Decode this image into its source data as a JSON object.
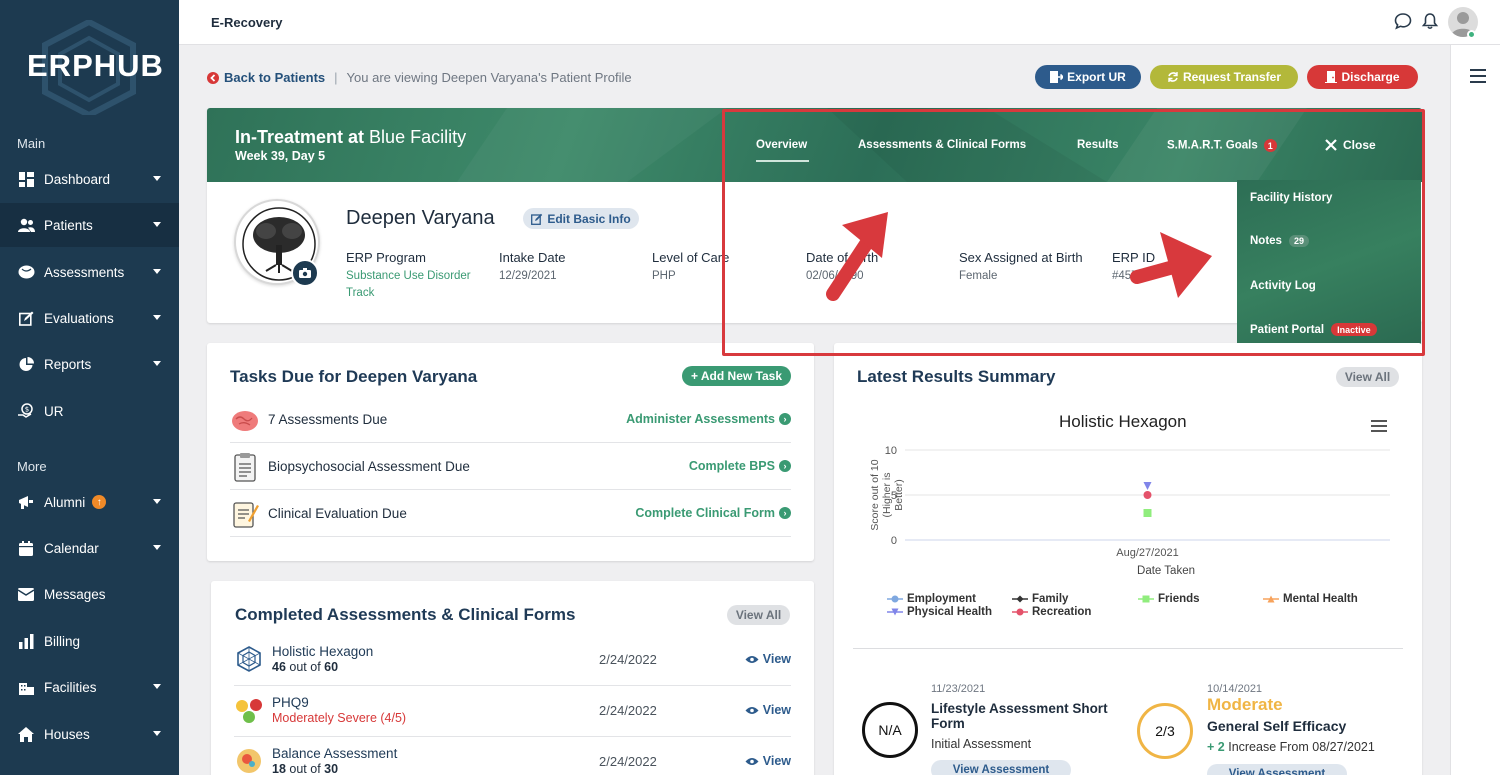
{
  "app": {
    "logo": "ERPHUB",
    "title": "E-Recovery"
  },
  "sidebar": {
    "section_main": "Main",
    "section_more": "More",
    "items": [
      {
        "label": "Dashboard",
        "icon": "dashboard-icon"
      },
      {
        "label": "Patients",
        "icon": "patients-icon"
      },
      {
        "label": "Assessments",
        "icon": "assessments-icon"
      },
      {
        "label": "Evaluations",
        "icon": "evaluations-icon"
      },
      {
        "label": "Reports",
        "icon": "reports-icon"
      },
      {
        "label": "UR",
        "icon": "ur-icon"
      },
      {
        "label": "Alumni",
        "icon": "alumni-icon",
        "badge": "↑"
      },
      {
        "label": "Calendar",
        "icon": "calendar-icon"
      },
      {
        "label": "Messages",
        "icon": "messages-icon"
      },
      {
        "label": "Billing",
        "icon": "billing-icon"
      },
      {
        "label": "Facilities",
        "icon": "facilities-icon"
      },
      {
        "label": "Houses",
        "icon": "houses-icon"
      }
    ]
  },
  "breadcrumb": {
    "back_label": "Back to Patients",
    "separator": "|",
    "viewing_text": "You are viewing Deepen Varyana's Patient Profile"
  },
  "actions": {
    "export": "Export UR",
    "transfer": "Request Transfer",
    "discharge": "Discharge"
  },
  "banner": {
    "status_bold": "In-Treatment at",
    "facility": "Blue Facility",
    "week": "Week 39, Day 5",
    "tabs": {
      "overview": "Overview",
      "assessments": "Assessments & Clinical Forms",
      "results": "Results",
      "goals": "S.M.A.R.T. Goals",
      "goals_badge": "1",
      "close": "Close"
    }
  },
  "dropdown": {
    "facility_history": "Facility History",
    "notes": "Notes",
    "notes_count": "29",
    "activity_log": "Activity Log",
    "patient_portal": "Patient Portal",
    "portal_status": "Inactive"
  },
  "patient": {
    "name": "Deepen Varyana",
    "edit_label": "Edit Basic Info",
    "fields": {
      "program_label": "ERP Program",
      "program_value_1": "Substance Use Disorder",
      "program_value_2": "Track",
      "intake_label": "Intake Date",
      "intake_value": "12/29/2021",
      "loc_label": "Level of Care",
      "loc_value": "PHP",
      "dob_label": "Date of Birth",
      "dob_value": "02/06/1990",
      "sex_label": "Sex Assigned at Birth",
      "sex_value": "Female",
      "erp_label": "ERP ID",
      "erp_value": "#4573"
    }
  },
  "tasks": {
    "title": "Tasks Due for Deepen Varyana",
    "add_label": "+ Add New Task",
    "rows": [
      {
        "text": "7 Assessments Due",
        "link": "Administer Assessments"
      },
      {
        "text": "Biopsychosocial Assessment Due",
        "link": "Complete BPS"
      },
      {
        "text": "Clinical Evaluation Due",
        "link": "Complete Clinical Form"
      }
    ]
  },
  "completed": {
    "title": "Completed Assessments & Clinical Forms",
    "view_all": "View All",
    "rows": [
      {
        "name": "Holistic Hexagon",
        "score_bold": "46",
        "score_rest": "out of",
        "score_total": "60",
        "date": "2/24/2022",
        "view": "View"
      },
      {
        "name": "PHQ9",
        "score_text": "Moderately Severe (4/5)",
        "date": "2/24/2022",
        "view": "View"
      },
      {
        "name": "Balance Assessment",
        "score_bold": "18",
        "score_rest": "out of",
        "score_total": "30",
        "date": "2/24/2022",
        "view": "View"
      }
    ]
  },
  "results": {
    "title": "Latest Results Summary",
    "view_all": "View All",
    "items": [
      {
        "circle": "N/A",
        "date": "11/23/2021",
        "title": "Lifestyle Assessment Short Form",
        "sub": "Initial Assessment",
        "button": "View Assessment"
      },
      {
        "circle": "2/3",
        "date": "10/14/2021",
        "level": "Moderate",
        "title": "General Self Efficacy",
        "change_num": "+ 2",
        "change_text": "Increase From 08/27/2021",
        "button": "View Assessment"
      }
    ]
  },
  "chart_data": {
    "type": "scatter",
    "title": "Holistic Hexagon",
    "xlabel": "Date Taken",
    "ylabel": "Score out of 10 (Higher is Better)",
    "ylim": [
      0,
      10
    ],
    "yticks": [
      "10",
      "5",
      "0"
    ],
    "categories": [
      "Aug/27/2021"
    ],
    "series": [
      {
        "name": "Employment",
        "color": "#7fa8e0",
        "marker": "circle",
        "values": [
          null
        ]
      },
      {
        "name": "Family",
        "color": "#333333",
        "marker": "diamond",
        "values": [
          null
        ]
      },
      {
        "name": "Friends",
        "color": "#90ed7d",
        "marker": "square",
        "values": [
          3
        ]
      },
      {
        "name": "Mental Health",
        "color": "#f7a35c",
        "marker": "triangle",
        "values": [
          null
        ]
      },
      {
        "name": "Physical Health",
        "color": "#8085e9",
        "marker": "triangle-down",
        "values": [
          6
        ]
      },
      {
        "name": "Recreation",
        "color": "#e4526a",
        "marker": "circle",
        "values": [
          5
        ]
      }
    ],
    "legend_position": "bottom"
  },
  "colors": {
    "sidebar": "#1d3a50",
    "accent_green": "#3a9a73",
    "brand_blue": "#2d5b8c",
    "danger": "#d73838",
    "annotation": "#d8393d"
  }
}
